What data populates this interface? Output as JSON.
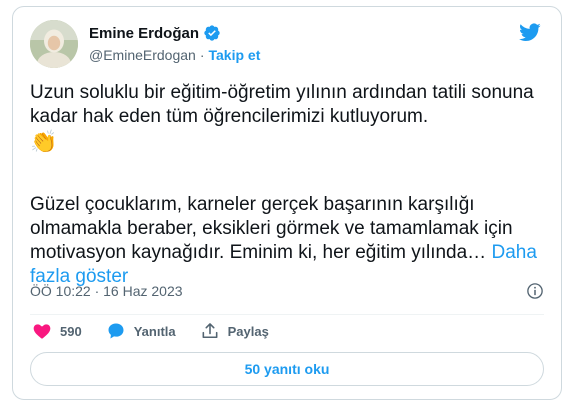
{
  "tweet": {
    "author": {
      "name": "Emine Erdoğan",
      "handle": "@EmineErdogan",
      "separator": "·",
      "follow_label": "Takip et",
      "verified": true
    },
    "text": {
      "paragraph1": "Uzun soluklu bir eğitim-öğretim yılının ardından tatili sonuna kadar hak eden tüm öğrencilerimizi kutluyorum.",
      "emoji": "👏",
      "paragraph2": "Güzel çocuklarım, karneler gerçek başarının karşılığı olmamakla beraber, eksikleri görmek ve tamamlamak için motivasyon kaynağıdır. Eminim ki, her eğitim yılında…",
      "show_more": "Daha fazla göster"
    },
    "timestamp": "ÖÖ 10:22 · 16 Haz 2023",
    "actions": {
      "like_count": "590",
      "reply_label": "Yanıtla",
      "share_label": "Paylaş"
    },
    "replies_button_label": "50 yanıtı oku"
  },
  "colors": {
    "accent": "#1d9bf0",
    "like": "#f91880",
    "text": "#0f1419",
    "muted": "#536471",
    "border": "#cfd9de"
  },
  "icons": [
    "verified-badge-icon",
    "twitter-bird-icon",
    "info-icon",
    "heart-icon",
    "reply-bubble-icon",
    "share-icon"
  ]
}
